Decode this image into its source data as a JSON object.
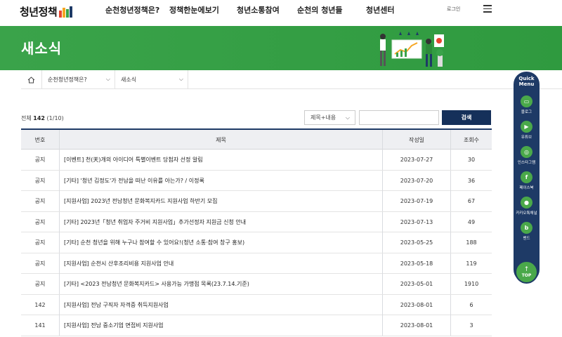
{
  "header": {
    "logo_text": "청년정책",
    "nav": [
      "순천청년정책은?",
      "정책한눈에보기",
      "청년소통참여",
      "순천의 청년들",
      "청년센터"
    ],
    "login": "로그인"
  },
  "banner": {
    "title": "새소식"
  },
  "breadcrumb": {
    "level1": "순천청년정책은?",
    "level2": "새소식"
  },
  "search": {
    "total_label": "전체",
    "total_count": "142",
    "page_info": "(1/10)",
    "select_value": "제목+내용",
    "input_value": "",
    "button": "검색"
  },
  "table": {
    "headers": [
      "번호",
      "제목",
      "작성일",
      "조회수"
    ],
    "rows": [
      {
        "no": "공지",
        "title": "[이벤트] 천(天)개의 아이디어 특별이벤트 당첨자 선정 알림",
        "date": "2023-07-27",
        "views": "30"
      },
      {
        "no": "공지",
        "title": "[기타] '청년 김정도'가 전남을 떠난 이유를 아는가? / 이정록",
        "date": "2023-07-20",
        "views": "36"
      },
      {
        "no": "공지",
        "title": "[지원사업] 2023년 전남청년 문화복지카드 지원사업 하반기 모집",
        "date": "2023-07-19",
        "views": "67"
      },
      {
        "no": "공지",
        "title": "[기타] 2023년「청년 취업자 주거비 지원사업」추가선정자 지원금 신청 안내",
        "date": "2023-07-13",
        "views": "49"
      },
      {
        "no": "공지",
        "title": "[기타] 순천 청년을 위해 누구나 참여할 수 있어요!(청년 소통·참여 창구 홍보)",
        "date": "2023-05-25",
        "views": "188"
      },
      {
        "no": "공지",
        "title": "[지원사업] 순천시 산후조리비용 지원사업 안내",
        "date": "2023-05-18",
        "views": "119"
      },
      {
        "no": "공지",
        "title": "[기타] <2023 전남청년 문화복지카드> 사용가능 가맹점 목록(23.7.14.기준)",
        "date": "2023-05-01",
        "views": "1910"
      },
      {
        "no": "142",
        "title": "[지원사업] 전남 구직자 자격증 취득지원사업",
        "date": "2023-08-01",
        "views": "6"
      },
      {
        "no": "141",
        "title": "[지원사업] 전남 중소기업 면접비 지원사업",
        "date": "2023-08-01",
        "views": "3"
      }
    ]
  },
  "quick_menu": {
    "title_line1": "Quick",
    "title_line2": "Menu",
    "items": [
      {
        "label": "블로그",
        "icon": "blog-icon",
        "glyph": "▭"
      },
      {
        "label": "유튜브",
        "icon": "youtube-icon",
        "glyph": "▶"
      },
      {
        "label": "인스타그램",
        "icon": "instagram-icon",
        "glyph": "◎"
      },
      {
        "label": "페이스북",
        "icon": "facebook-icon",
        "glyph": "f"
      },
      {
        "label": "카카오톡채널",
        "icon": "kakao-icon",
        "glyph": "●"
      },
      {
        "label": "밴드",
        "icon": "band-icon",
        "glyph": "b"
      }
    ],
    "top_label": "TOP"
  },
  "colors": {
    "banner_green": "#3aa34a",
    "navy": "#1e3a66",
    "button_navy": "#15305a",
    "quick_green": "#4aa84a"
  }
}
